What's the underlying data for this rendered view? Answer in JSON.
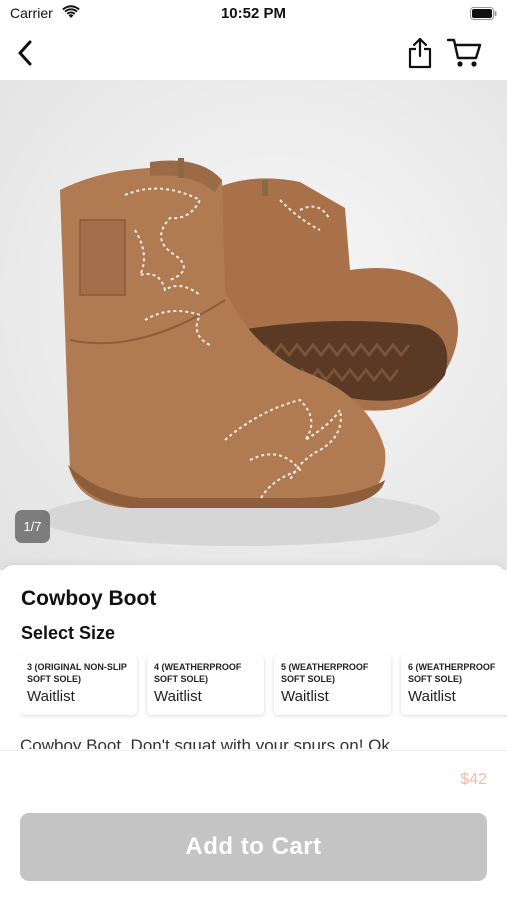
{
  "status_bar": {
    "carrier": "Carrier",
    "time": "10:52 PM"
  },
  "nav": {
    "back_icon": "chevron-left-icon",
    "share_icon": "share-icon",
    "cart_icon": "cart-icon"
  },
  "gallery": {
    "counter": "1/7"
  },
  "product": {
    "title": "Cowboy Boot",
    "size_heading": "Select Size",
    "sizes": [
      {
        "name": "3 (ORIGINAL NON-SLIP SOFT SOLE)",
        "status": "Waitlist"
      },
      {
        "name": "4 (WEATHERPROOF SOFT SOLE)",
        "status": "Waitlist"
      },
      {
        "name": "5 (WEATHERPROOF SOFT SOLE)",
        "status": "Waitlist"
      },
      {
        "name": "6 (WEATHERPROOF SOFT SOLE)",
        "status": "Waitlist"
      }
    ],
    "description": "Cowboy Boot. Don't squat with your spurs on! Ok"
  },
  "footer": {
    "price": "$42",
    "add_to_cart_label": "Add to Cart"
  },
  "colors": {
    "price": "#f2b9a3",
    "button_disabled": "#c4c4c4",
    "boot_leather": "#b07a52"
  }
}
